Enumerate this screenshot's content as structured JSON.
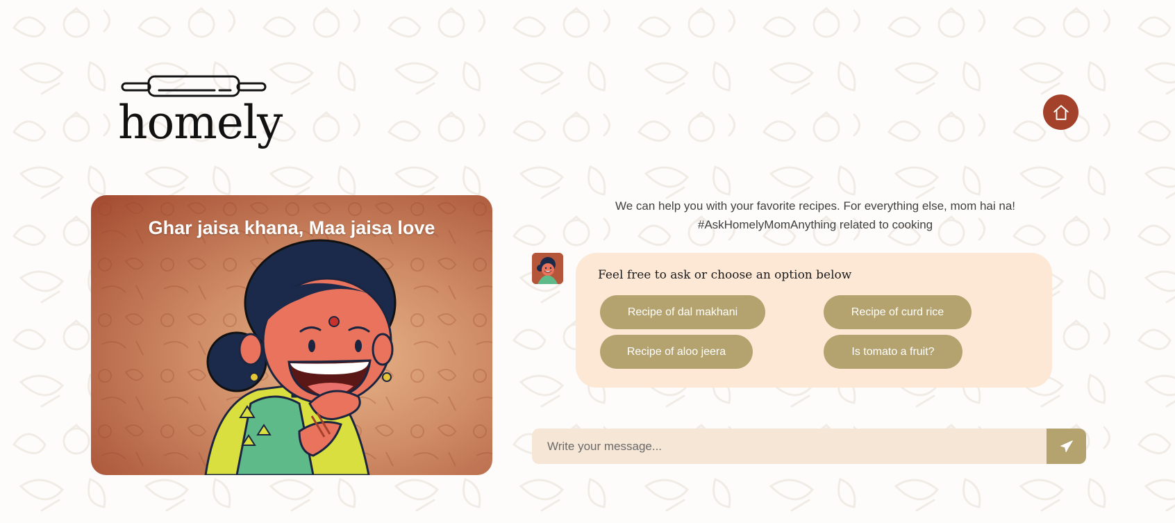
{
  "brand": {
    "name": "homely",
    "logo_icon": "rolling-pin-icon"
  },
  "header": {
    "home_icon": "home-icon",
    "home_color": "#a3412b"
  },
  "hero": {
    "title": "Ghar jaisa khana, Maa jaisa love",
    "art": "mom-illustration"
  },
  "chat": {
    "intro": "We can help you with your favorite recipes. For everything else, mom hai na! #AskHomelyMomAnything related to cooking",
    "prompt": "Feel free to ask or choose an option below",
    "options": [
      {
        "label": "Recipe of dal makhani"
      },
      {
        "label": "Recipe of curd rice"
      },
      {
        "label": "Recipe of aloo jeera"
      },
      {
        "label": "Is tomato a fruit?"
      }
    ],
    "input": {
      "placeholder": "Write your message...",
      "value": ""
    },
    "send_icon": "paper-plane-icon"
  },
  "colors": {
    "accent": "#a3412b",
    "option_bg": "#b4a36f",
    "bubble_bg": "#fde8d6",
    "input_bg": "#f5e6d6"
  }
}
